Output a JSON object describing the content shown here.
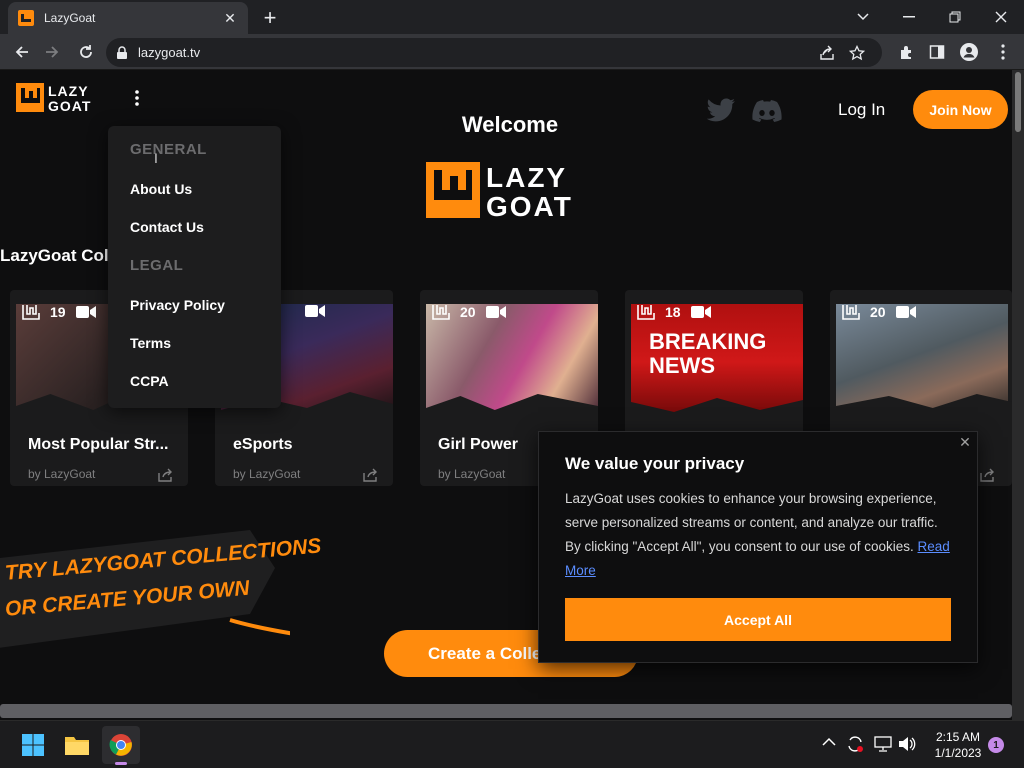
{
  "browser": {
    "tab_title": "LazyGoat",
    "url": "lazygoat.tv"
  },
  "header": {
    "welcome": "Welcome",
    "login": "Log In",
    "join": "Join Now"
  },
  "menu": {
    "general_heading": "GENERAL",
    "items_general": [
      "About Us",
      "Contact Us"
    ],
    "legal_heading": "LEGAL",
    "items_legal": [
      "Privacy Policy",
      "Terms",
      "CCPA"
    ]
  },
  "collections": {
    "section_title": "LazyGoat Collections",
    "cards": [
      {
        "count": "19",
        "title": "Most Popular Str...",
        "by": "by LazyGoat"
      },
      {
        "count": "",
        "title": "eSports",
        "by": "by LazyGoat"
      },
      {
        "count": "20",
        "title": "Girl Power",
        "by": "by LazyGoat"
      },
      {
        "count": "18",
        "title": "",
        "by": "",
        "thumb_text": "BREAKING NEWS"
      },
      {
        "count": "20",
        "title": "",
        "by": ""
      }
    ]
  },
  "banner": {
    "line1": "TRY LAZYGOAT COLLECTIONS",
    "line2": "OR CREATE YOUR OWN"
  },
  "create_button": "Create a Collection",
  "cookie": {
    "title": "We value your privacy",
    "body": "LazyGoat uses cookies to enhance your browsing experience, serve personalized streams or content, and analyze our traffic. By clicking \"Accept All\", you consent to our use of cookies.",
    "link": "Read More",
    "accept": "Accept All"
  },
  "taskbar": {
    "time": "2:15 AM",
    "date": "1/1/2023",
    "notification_count": "1"
  },
  "colors": {
    "brand_orange": "#ff8b0d",
    "page_bg": "#0e0e0f",
    "link_blue": "#5b8dff"
  }
}
